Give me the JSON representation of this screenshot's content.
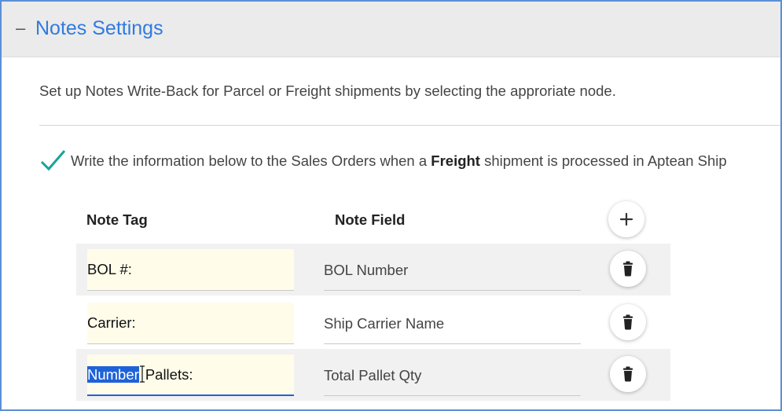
{
  "section": {
    "toggle_symbol": "–",
    "title": "Notes Settings"
  },
  "description": "Set up Notes Write-Back for Parcel or Freight shipments by selecting the approriate node.",
  "write_back": {
    "checked": true,
    "text_before": "Write the information below to the Sales Orders when a ",
    "text_bold": "Freight",
    "text_after": " shipment is processed in Aptean Ship"
  },
  "columns": {
    "note_tag": "Note Tag",
    "note_field": "Note Field"
  },
  "add_button_icon": "plus-icon",
  "delete_button_icon": "trash-icon",
  "rows": [
    {
      "tag": "BOL #:",
      "field": "BOL Number"
    },
    {
      "tag": "Carrier:",
      "field": "Ship Carrier Name"
    },
    {
      "tag_selected": "Number",
      "tag_rest": "Pallets:",
      "field": "Total Pallet Qty"
    }
  ],
  "colors": {
    "accent": "#2f7be0",
    "check": "#17a39a",
    "selection": "#1f62d8",
    "tag_field_bg": "#fffcea"
  }
}
